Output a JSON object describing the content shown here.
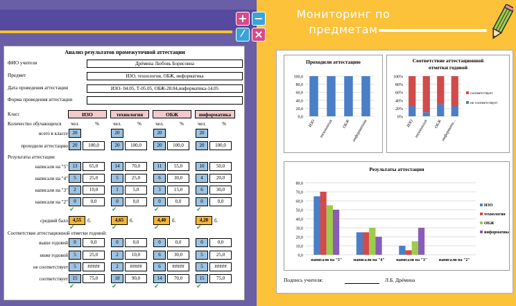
{
  "slide": {
    "title_line1": "Мониторинг по",
    "title_line2": "предметам",
    "icons": [
      "plus-icon",
      "minus-icon",
      "divide-icon",
      "multiply-icon",
      "pencil-icon"
    ],
    "colors": {
      "background_left": "#6a5ea6",
      "background_right": "#fbc23a",
      "accent": "#f5c230"
    }
  },
  "sheet": {
    "title": "Анализ результатов промежуточной аттестации",
    "fio_label": "ФИО учителя",
    "fio_value": "Дрёмина Любовь Борисовна",
    "subject_label": "Предмет",
    "subject_value": "ИЗО, технология, ОБЖ, информатика",
    "date_label": "Дата проведения аттестации",
    "date_value": "ИЗО- 04.05, Т-05.05, ОБЖ-28.04,информатика-14.05",
    "form_label": "Форма проведения аттестации",
    "form_value": "",
    "class_label": "Класс",
    "subjects": [
      "ИЗО",
      "технология",
      "ОБЖ",
      "информатика"
    ],
    "col_count": "чел.",
    "col_pct": "%",
    "count_label": "Количество обучающихся",
    "row_labels": {
      "total": "всего в классе",
      "passed": "проходили аттестацию",
      "results": "Результаты аттестации",
      "g5": "написали на \"5\"",
      "g4": "написали на \"4\"",
      "g3": "написали на \"3\"",
      "g2": "написали на \"2\"",
      "avg": "средний балл",
      "match": "Соответствие аттестационной отметки годовой:",
      "higher": "выше годовой",
      "lower": "ниже годовой",
      "nomatch": "не соответствует",
      "matches": "соответствует"
    },
    "avg_unit": "б.",
    "data": [
      {
        "total": "20",
        "passed": [
          "20",
          "100,0"
        ],
        "g5": [
          "13",
          "65,0"
        ],
        "g4": [
          "5",
          "25,0"
        ],
        "g3": [
          "2",
          "10,0"
        ],
        "g2": [
          "0",
          "0,0"
        ],
        "avg": "4,55",
        "higher": [
          "0",
          "0,0"
        ],
        "lower": [
          "5",
          "25,0"
        ],
        "nomatch": [
          "5",
          "#####"
        ],
        "matches": [
          "15",
          "75,0"
        ]
      },
      {
        "total": "20",
        "passed": [
          "20",
          "100,0"
        ],
        "g5": [
          "14",
          "70,0"
        ],
        "g4": [
          "5",
          "25,0"
        ],
        "g3": [
          "1",
          "5,0"
        ],
        "g2": [
          "0",
          "0,0"
        ],
        "avg": "4,65",
        "higher": [
          "0",
          "0,0"
        ],
        "lower": [
          "2",
          "10,0"
        ],
        "nomatch": [
          "2",
          "#####"
        ],
        "matches": [
          "18",
          "90,0"
        ]
      },
      {
        "total": "20",
        "passed": [
          "20",
          "100,0"
        ],
        "g5": [
          "11",
          "55,0"
        ],
        "g4": [
          "6",
          "30,0"
        ],
        "g3": [
          "3",
          "15,0"
        ],
        "g2": [
          "0",
          "0,0"
        ],
        "avg": "4,40",
        "higher": [
          "0",
          "0,0"
        ],
        "lower": [
          "6",
          "30,0"
        ],
        "nomatch": [
          "6",
          "#####"
        ],
        "matches": [
          "14",
          "70,0"
        ]
      },
      {
        "total": "20",
        "passed": [
          "20",
          "100,0"
        ],
        "g5": [
          "10",
          "50,0"
        ],
        "g4": [
          "4",
          "20,0"
        ],
        "g3": [
          "6",
          "30,0"
        ],
        "g2": [
          "0",
          "0,0"
        ],
        "avg": "4,20",
        "higher": [
          "0",
          "0,0"
        ],
        "lower": [
          "5",
          "25,0"
        ],
        "nomatch": [
          "5",
          "#####"
        ],
        "matches": [
          "15",
          "75,0"
        ]
      }
    ],
    "colors": {
      "subject_header": "#f3c9c9",
      "count_cell": "#9cc3e3",
      "avg_cell": "#f4b43a",
      "check": "#2fa24a"
    }
  },
  "charts": {
    "sign_label": "Подпись учителя:",
    "sign_name": "Л.Б. Дрёмина"
  },
  "chart_data": [
    {
      "type": "bar",
      "title": "Проходили аттестацию",
      "categories": [
        "ИЗО",
        "технология",
        "ОБЖ",
        "информатика"
      ],
      "values": [
        100,
        100,
        100,
        100
      ],
      "ylim": [
        0,
        100
      ],
      "yticks": [
        "0,0",
        "20,0",
        "40,0",
        "60,0",
        "80,0",
        "100,0"
      ],
      "color": "#4a7fc6"
    },
    {
      "type": "bar",
      "stacked": true,
      "title_line1": "Соответствие аттестационной",
      "title_line2": "отметки годовой",
      "categories": [
        "ИЗО",
        "технология",
        "ОБЖ",
        "информати..."
      ],
      "series": [
        {
          "name": "не соответствует",
          "values": [
            25,
            10,
            30,
            25
          ],
          "color": "#4a7fc6"
        },
        {
          "name": "соответствует",
          "values": [
            75,
            90,
            70,
            75
          ],
          "color": "#d24a4a"
        }
      ],
      "ylim": [
        0,
        100
      ],
      "yticks": [
        "0%",
        "20%",
        "40%",
        "60%",
        "80%",
        "100%"
      ],
      "legend": "right"
    },
    {
      "type": "bar",
      "title": "Результаты аттестации",
      "categories": [
        "написали на \"5\"",
        "написали на \"4\"",
        "написали на \"3\"",
        "написали на \"2\""
      ],
      "series": [
        {
          "name": "ИЗО",
          "values": [
            65,
            25,
            10,
            0
          ],
          "color": "#4a7fc6"
        },
        {
          "name": "технология",
          "values": [
            70,
            25,
            5,
            0
          ],
          "color": "#d24a4a"
        },
        {
          "name": "ОБЖ",
          "values": [
            55,
            30,
            15,
            0
          ],
          "color": "#9ccc4a"
        },
        {
          "name": "информатика",
          "values": [
            50,
            20,
            30,
            0
          ],
          "color": "#8a5cb8"
        }
      ],
      "ylim": [
        0,
        80
      ],
      "yticks": [
        "0,0",
        "10,0",
        "20,0",
        "30,0",
        "40,0",
        "50,0",
        "60,0",
        "70,0",
        "80,0"
      ],
      "legend": "right"
    }
  ]
}
